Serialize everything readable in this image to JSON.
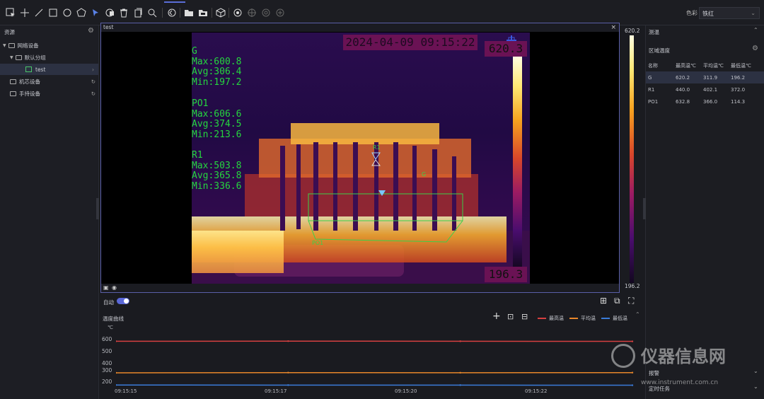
{
  "toolbar": {
    "palette_label": "色彩",
    "palette_value": "铁红",
    "tools": [
      "select-tool",
      "crosshair-tool",
      "line-tool",
      "rectangle-tool",
      "circle-tool",
      "polygon-tool",
      "pointer-tool",
      "palette-tool",
      "delete-tool",
      "copy-tool",
      "zoom-tool",
      "rotate-tool",
      "folder-tool",
      "folder-open-tool",
      "cube-tool",
      "settings-tool",
      "target-tool",
      "circle-target-tool",
      "grid-target-tool"
    ]
  },
  "left_panel": {
    "title": "资源",
    "items": [
      {
        "label": "网络设备",
        "level": 0
      },
      {
        "label": "默认分组",
        "level": 1
      },
      {
        "label": "test",
        "level": 2
      },
      {
        "label": "机芯设备",
        "level": 0
      },
      {
        "label": "手持设备",
        "level": 0
      }
    ]
  },
  "viewer": {
    "tab_title": "test",
    "timestamp": "2024-04-09 09:15:22",
    "max_temp": "620.3",
    "min_temp": "196.3",
    "scale_top": "620.2",
    "scale_bottom": "196.2",
    "overlay": [
      {
        "name": "G",
        "max": "Max:600.8",
        "avg": "Avg:306.4",
        "min": "Min:197.2"
      },
      {
        "name": "PO1",
        "max": "Max:606.6",
        "avg": "Avg:374.5",
        "min": "Min:213.6"
      },
      {
        "name": "R1",
        "max": "Max:503.8",
        "avg": "Avg:365.8",
        "min": "Min:336.6"
      }
    ],
    "auto_label": "自动"
  },
  "right_panel": {
    "measure_title": "测温",
    "region_title": "区域温度",
    "columns": [
      "名称",
      "最高温℃",
      "平均温℃",
      "最低温℃"
    ],
    "rows": [
      [
        "G",
        "620.2",
        "311.9",
        "196.2"
      ],
      [
        "R1",
        "440.0",
        "402.1",
        "372.0"
      ],
      [
        "PO1",
        "632.8",
        "366.0",
        "114.3"
      ]
    ],
    "alarm_label": "报警",
    "task_label": "定时任务"
  },
  "curve": {
    "title": "温度曲线",
    "unit": "℃",
    "legend": [
      {
        "name": "最高温",
        "color": "#d64040"
      },
      {
        "name": "平均温",
        "color": "#e8872a"
      },
      {
        "name": "最低温",
        "color": "#3a7bd8"
      }
    ]
  },
  "chart_data": {
    "type": "line",
    "ylabel": "℃",
    "ylim": [
      180,
      700
    ],
    "yticks": [
      "600",
      "500",
      "400",
      "300",
      "200"
    ],
    "x": [
      "09:15:15",
      "09:15:17",
      "09:15:20",
      "09:15:22"
    ],
    "series": [
      {
        "name": "最高温",
        "values": [
          600,
          601,
          600,
          599
        ]
      },
      {
        "name": "平均温",
        "values": [
          310,
          312,
          311,
          312
        ]
      },
      {
        "name": "最低温",
        "values": [
          198,
          197,
          197,
          196
        ]
      }
    ]
  },
  "watermark": {
    "brand": "仪器信息网",
    "url": "www.instrument.com.cn"
  }
}
